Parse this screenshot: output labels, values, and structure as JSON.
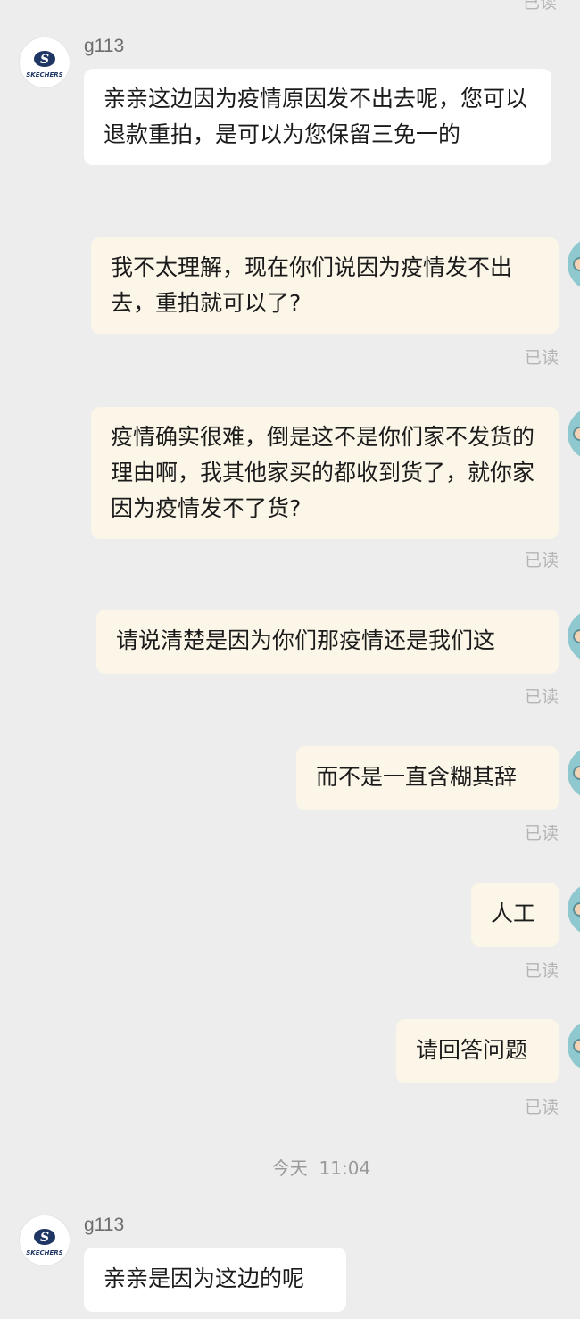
{
  "top_status": "已读",
  "contact": {
    "name": "g113",
    "avatar_logo": "SKECHERS"
  },
  "messages": [
    {
      "direction": "incoming",
      "text": "亲亲这边因为疫情原因发不出去呢，您可以退款重拍，是可以为您保留三免一的"
    },
    {
      "direction": "outgoing",
      "text": "我不太理解，现在你们说因为疫情发不出去，重拍就可以了?",
      "status": "已读"
    },
    {
      "direction": "outgoing",
      "text": "疫情确实很难，倒是这不是你们家不发货的理由啊，我其他家买的都收到货了，就你家因为疫情发不了货?",
      "status": "已读"
    },
    {
      "direction": "outgoing",
      "text": "请说清楚是因为你们那疫情还是我们这",
      "status": "已读"
    },
    {
      "direction": "outgoing",
      "text": "而不是一直含糊其辞",
      "status": "已读"
    },
    {
      "direction": "outgoing",
      "text": "人工",
      "status": "已读"
    },
    {
      "direction": "outgoing",
      "text": "请回答问题",
      "status": "已读"
    },
    {
      "direction": "incoming",
      "text": "亲亲是因为这边的呢"
    }
  ],
  "time_divider": "今天  11:04",
  "colors": {
    "background": "#ededed",
    "incoming_bubble": "#ffffff",
    "outgoing_bubble": "#fcf6e8",
    "read_status": "#b5b5b5",
    "brand_navy": "#1f3563"
  }
}
